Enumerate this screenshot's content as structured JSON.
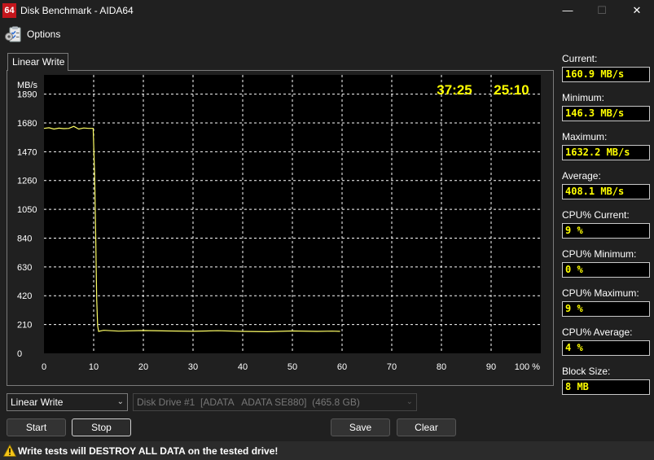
{
  "window": {
    "app_icon_text": "64",
    "title": "Disk Benchmark - AIDA64",
    "minimize_glyph": "—",
    "maximize_glyph": "☐",
    "close_glyph": "✕"
  },
  "menu": {
    "options_label": "Options",
    "options_icon": "options-checklist-icon"
  },
  "tab": {
    "label": "Linear Write"
  },
  "chart_data": {
    "type": "line",
    "yunit": "MB/s",
    "yticks": [
      0,
      210,
      420,
      630,
      840,
      1050,
      1260,
      1470,
      1680,
      1890
    ],
    "ylim": [
      0,
      2030
    ],
    "xticks": [
      "0",
      "10",
      "20",
      "30",
      "40",
      "50",
      "60",
      "70",
      "80",
      "90",
      "100 %"
    ],
    "xlim": [
      0,
      100
    ],
    "grid": true,
    "timer_left": "37:25",
    "timer_right": "25:10",
    "colors": {
      "line": "#ffff66",
      "grid": "#ffffff",
      "background": "#000000",
      "timer": "#ffff00"
    },
    "series": [
      {
        "x": [
          0,
          1,
          2,
          3,
          4,
          5,
          6,
          7,
          8,
          9,
          9.9,
          10.2,
          10.4,
          10.6,
          10.8,
          11,
          12,
          15,
          20,
          25,
          30,
          35,
          40,
          45,
          50,
          55,
          58,
          59.6
        ],
        "y": [
          1640,
          1645,
          1635,
          1642,
          1638,
          1640,
          1655,
          1635,
          1643,
          1640,
          1640,
          1300,
          900,
          400,
          200,
          160,
          168,
          162,
          166,
          163,
          161,
          165,
          160,
          158,
          163,
          160,
          162,
          160
        ]
      }
    ]
  },
  "stats": [
    {
      "label": "Current:",
      "value": "160.9 MB/s"
    },
    {
      "label": "Minimum:",
      "value": "146.3 MB/s"
    },
    {
      "label": "Maximum:",
      "value": "1632.2 MB/s"
    },
    {
      "label": "Average:",
      "value": "408.1 MB/s"
    },
    {
      "label": "CPU% Current:",
      "value": "9 %"
    },
    {
      "label": "CPU% Minimum:",
      "value": "0 %"
    },
    {
      "label": "CPU% Maximum:",
      "value": "9 %"
    },
    {
      "label": "CPU% Average:",
      "value": "4 %"
    },
    {
      "label": "Block Size:",
      "value": "8 MB"
    }
  ],
  "controls": {
    "test_select": "Linear Write",
    "drive_select": "Disk Drive #1  [ADATA   ADATA SE880]  (465.8 GB)",
    "chevron": "⌄",
    "start": "Start",
    "stop": "Stop",
    "save": "Save",
    "clear": "Clear"
  },
  "warning": {
    "text": "Write tests will DESTROY ALL DATA on the tested drive!",
    "icon": "warning-triangle-icon"
  }
}
